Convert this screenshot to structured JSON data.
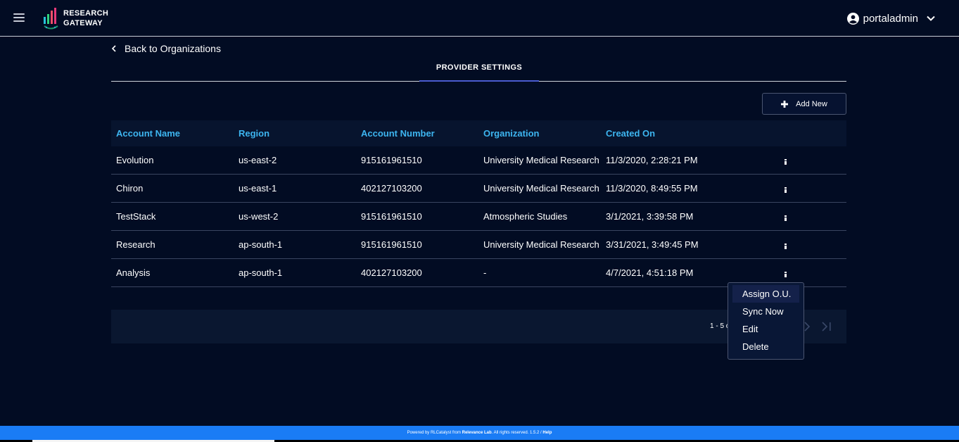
{
  "header": {
    "logo_line1": "RESEARCH",
    "logo_line2": "GATEWAY",
    "username": "portaladmin"
  },
  "nav": {
    "back_label": "Back to Organizations"
  },
  "tabs": [
    {
      "label": "PROVIDER SETTINGS"
    }
  ],
  "toolbar": {
    "add_label": "Add New"
  },
  "table": {
    "columns": [
      "Account Name",
      "Region",
      "Account Number",
      "Organization",
      "Created On"
    ],
    "rows": [
      [
        "Evolution",
        "us-east-2",
        "915161961510",
        "University Medical Research",
        "11/3/2020, 2:28:21 PM"
      ],
      [
        "Chiron",
        "us-east-1",
        "402127103200",
        "University Medical Research",
        "11/3/2020, 8:49:55 PM"
      ],
      [
        "TestStack",
        "us-west-2",
        "915161961510",
        "Atmospheric Studies",
        "3/1/2021, 3:39:58 PM"
      ],
      [
        "Research",
        "ap-south-1",
        "915161961510",
        "University Medical Research",
        "3/31/2021, 3:49:45 PM"
      ],
      [
        "Analysis",
        "ap-south-1",
        "402127103200",
        "-",
        "4/7/2021, 4:51:18 PM"
      ]
    ]
  },
  "pager": {
    "range_text": "1 - 5 o"
  },
  "context_menu": {
    "items": [
      "Assign O.U.",
      "Sync Now",
      "Edit",
      "Delete"
    ]
  },
  "footer": {
    "text_prefix": "Powered by RLCatalyst from ",
    "company": "Relevance Lab",
    "text_suffix": ". All rights reserved. 1.5.2 / ",
    "help": "Help"
  },
  "colors": {
    "background": "#020c23",
    "header_text": "#3db5f0",
    "footer_bar": "#1a7cf5",
    "tab_underline": "#4a5cd0"
  },
  "icons": [
    "menu-icon",
    "user-avatar-icon",
    "chevron-down-icon",
    "chevron-left-icon",
    "plus-icon",
    "more-vertical-icon",
    "chevron-right-icon",
    "last-page-icon"
  ]
}
